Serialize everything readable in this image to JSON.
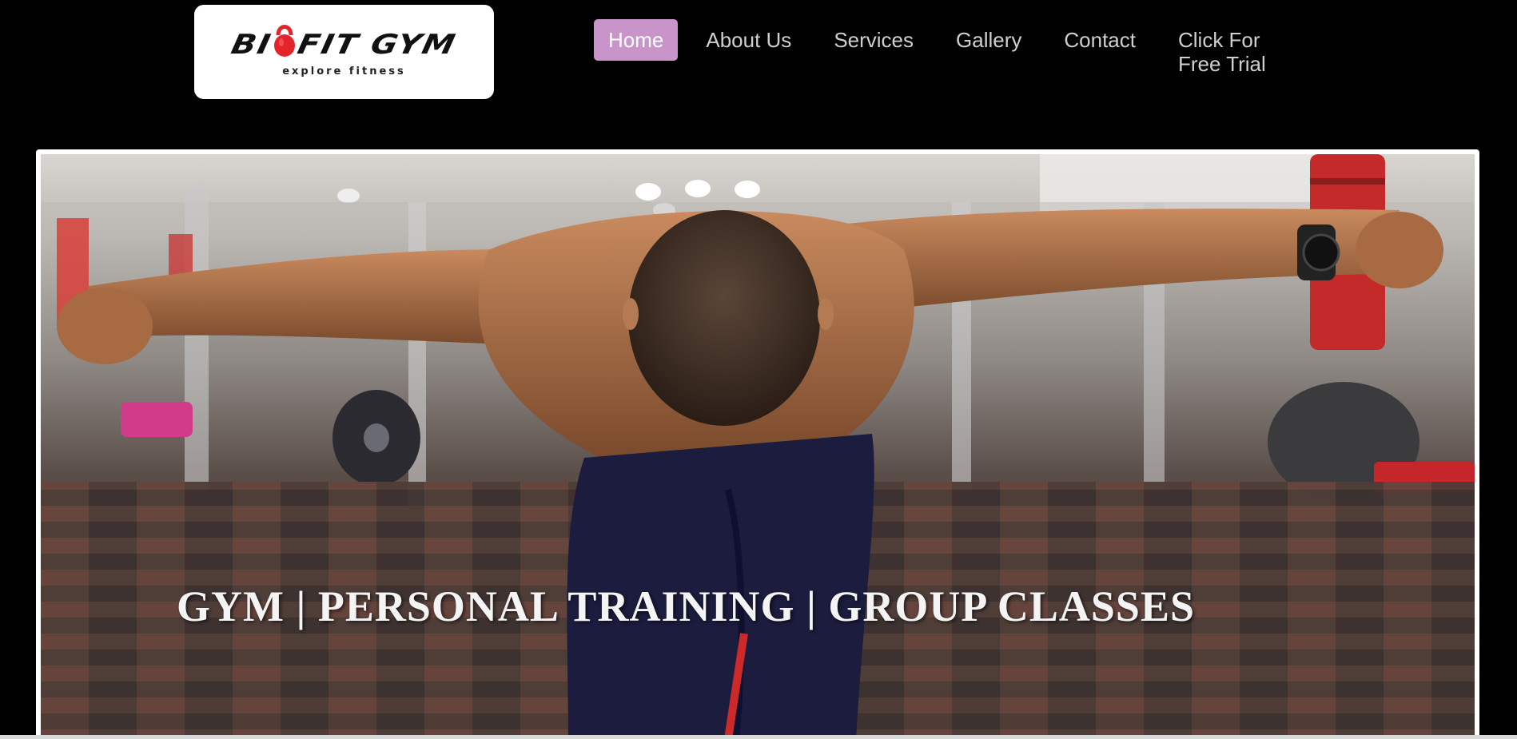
{
  "brand": {
    "logo_part1": "BI",
    "logo_part2": "FIT GYM",
    "tagline": "explore fitness",
    "accent_color": "#e3242b"
  },
  "nav": {
    "items": [
      {
        "label": "Home",
        "active": true
      },
      {
        "label": "About Us",
        "active": false
      },
      {
        "label": "Services",
        "active": false
      },
      {
        "label": "Gallery",
        "active": false
      },
      {
        "label": "Contact",
        "active": false
      }
    ],
    "trial_line1": "Click For",
    "trial_line2": "Free Trial",
    "active_color": "#c994c9"
  },
  "hero": {
    "caption": "GYM | PERSONAL TRAINING | GROUP CLASSES"
  }
}
